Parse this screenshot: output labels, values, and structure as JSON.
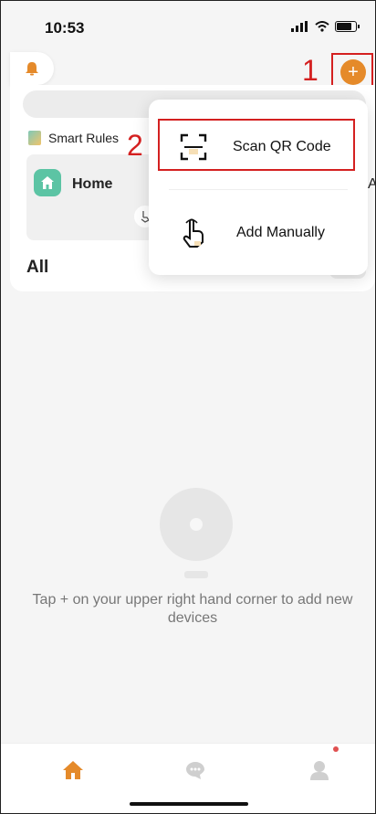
{
  "status_bar": {
    "time": "10:53"
  },
  "header": {
    "add_label": "+"
  },
  "annotations": {
    "step1": "1",
    "step2": "2"
  },
  "smart_rules": {
    "label": "Smart Rules"
  },
  "home_card": {
    "label": "Home"
  },
  "next_card": {
    "label": "A"
  },
  "section": {
    "all_label": "All"
  },
  "dropdown": {
    "items": [
      {
        "label": "Scan QR Code",
        "icon": "scan-qr-icon"
      },
      {
        "label": "Add Manually",
        "icon": "tap-hand-icon"
      }
    ]
  },
  "empty_state": {
    "text": "Tap + on your upper right hand corner to add new devices"
  },
  "tab_bar": {
    "items": [
      {
        "icon": "home-icon",
        "active": true
      },
      {
        "icon": "chat-icon",
        "active": false
      },
      {
        "icon": "profile-icon",
        "active": false,
        "badge": true
      }
    ]
  },
  "colors": {
    "accent": "#e58a2a",
    "annotation": "#d42020",
    "home_green": "#5cc4a4"
  }
}
